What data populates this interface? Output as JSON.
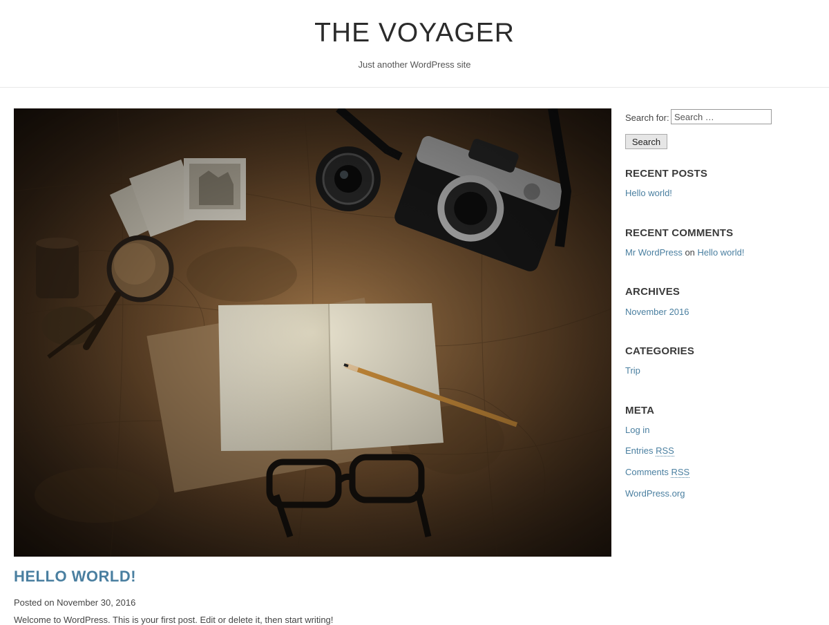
{
  "header": {
    "site_title": "THE VOYAGER",
    "tagline": "Just another WordPress site"
  },
  "post": {
    "title": "HELLO WORLD!",
    "meta_prefix": "Posted on",
    "date": "November 30, 2016",
    "excerpt": "Welcome to WordPress. This is your first post. Edit or delete it, then start writing!"
  },
  "sidebar": {
    "search": {
      "label": "Search for:",
      "placeholder": "Search …",
      "button": "Search"
    },
    "recent_posts": {
      "title": "RECENT POSTS",
      "items": [
        "Hello world!"
      ]
    },
    "recent_comments": {
      "title": "RECENT COMMENTS",
      "author": "Mr WordPress",
      "on": "on",
      "post": "Hello world!"
    },
    "archives": {
      "title": "ARCHIVES",
      "items": [
        "November 2016"
      ]
    },
    "categories": {
      "title": "CATEGORIES",
      "items": [
        "Trip"
      ]
    },
    "meta": {
      "title": "META",
      "login": "Log in",
      "entries_prefix": "Entries",
      "comments_prefix": "Comments",
      "rss": "RSS",
      "wordpress_org": "WordPress.org"
    }
  },
  "colors": {
    "link": "#4a7fa0",
    "heading": "#3a3a3a"
  }
}
